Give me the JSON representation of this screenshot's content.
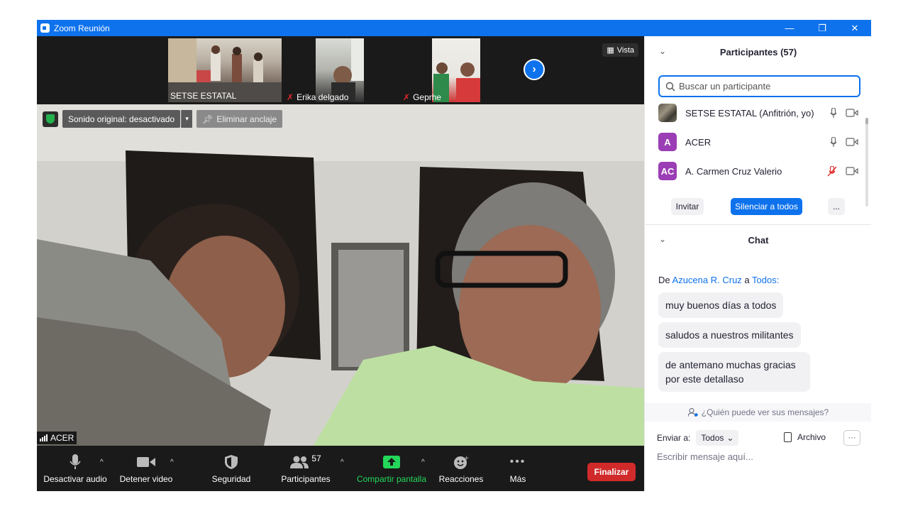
{
  "window": {
    "title": "Zoom Reunión",
    "minimize": "—",
    "restore": "❐",
    "close": "✕"
  },
  "video": {
    "thumbnails": [
      {
        "name": "SETSE ESTATAL",
        "muted": false
      },
      {
        "name": "Erika delgado",
        "muted": true
      },
      {
        "name": "Geprhe",
        "muted": true
      }
    ],
    "view_label": "Vista",
    "original_sound": "Sonido original: desactivado",
    "unpin": "Eliminar anclaje",
    "active_speaker": "ACER"
  },
  "toolbar": {
    "mute": "Desactivar audio",
    "stop_video": "Detener video",
    "security": "Seguridad",
    "participants": "Participantes",
    "participants_count": "57",
    "share": "Compartir pantalla",
    "reactions": "Reacciones",
    "more": "Más",
    "end": "Finalizar",
    "colors": {
      "end": "#d12a2a",
      "share": "#24d75a",
      "accent": "#0e72ed"
    }
  },
  "participants": {
    "title": "Participantes (57)",
    "search_placeholder": "Buscar un participante",
    "list": [
      {
        "initials": "",
        "name": "SETSE ESTATAL (Anfitrión, yo)",
        "mic": "on"
      },
      {
        "initials": "A",
        "name": "ACER",
        "mic": "on"
      },
      {
        "initials": "AC",
        "name": "A. Carmen Cruz Valerio",
        "mic": "muted"
      }
    ],
    "invite": "Invitar",
    "mute_all": "Silenciar a todos",
    "more": "..."
  },
  "chat": {
    "title": "Chat",
    "from_prefix": "De",
    "from_name": "Azucena R. Cruz",
    "to_prefix": "a",
    "to_name": "Todos:",
    "messages": [
      "muy buenos días a todos",
      "saludos a nuestros militantes",
      "de antemano muchas gracias por este detallaso"
    ],
    "who_can_see": "¿Quién puede ver sus mensajes?",
    "send_to_label": "Enviar a:",
    "send_to_value": "Todos",
    "file_label": "Archivo",
    "input_placeholder": "Escribir mensaje aquí..."
  }
}
